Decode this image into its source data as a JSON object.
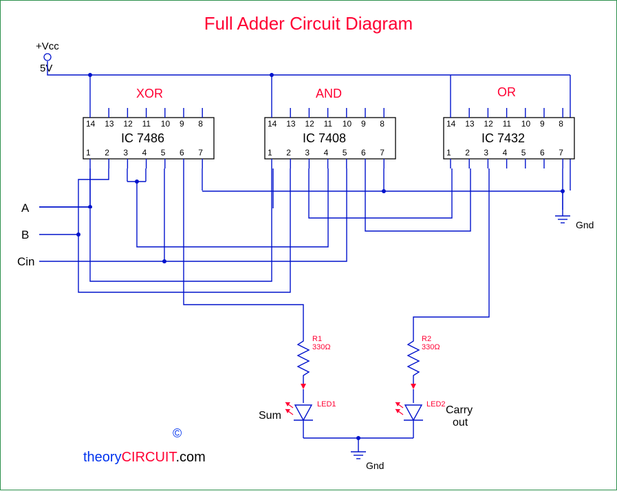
{
  "title": "Full Adder Circuit Diagram",
  "power": {
    "vcc": "+Vcc",
    "volt": "5V"
  },
  "gates": {
    "g1": "XOR",
    "g2": "AND",
    "g3": "OR"
  },
  "ics": {
    "ic1": "IC 7486",
    "ic2": "IC 7408",
    "ic3": "IC 7432"
  },
  "pins_top": [
    "14",
    "13",
    "12",
    "11",
    "10",
    "9",
    "8"
  ],
  "pins_bottom": [
    "1",
    "2",
    "3",
    "4",
    "5",
    "6",
    "7"
  ],
  "inputs": {
    "a": "A",
    "b": "B",
    "cin": "Cin"
  },
  "gnd": "Gnd",
  "components": {
    "r1_name": "R1",
    "r1_val": "330Ω",
    "r2_name": "R2",
    "r2_val": "330Ω",
    "led1": "LED1",
    "led2": "LED2"
  },
  "outputs": {
    "sum": "Sum",
    "carry1": "Carry",
    "carry2": "out"
  },
  "attrib": {
    "t1": "theory",
    "t2": "CIRCUIT",
    "t3": ".com",
    "copy": "©"
  }
}
